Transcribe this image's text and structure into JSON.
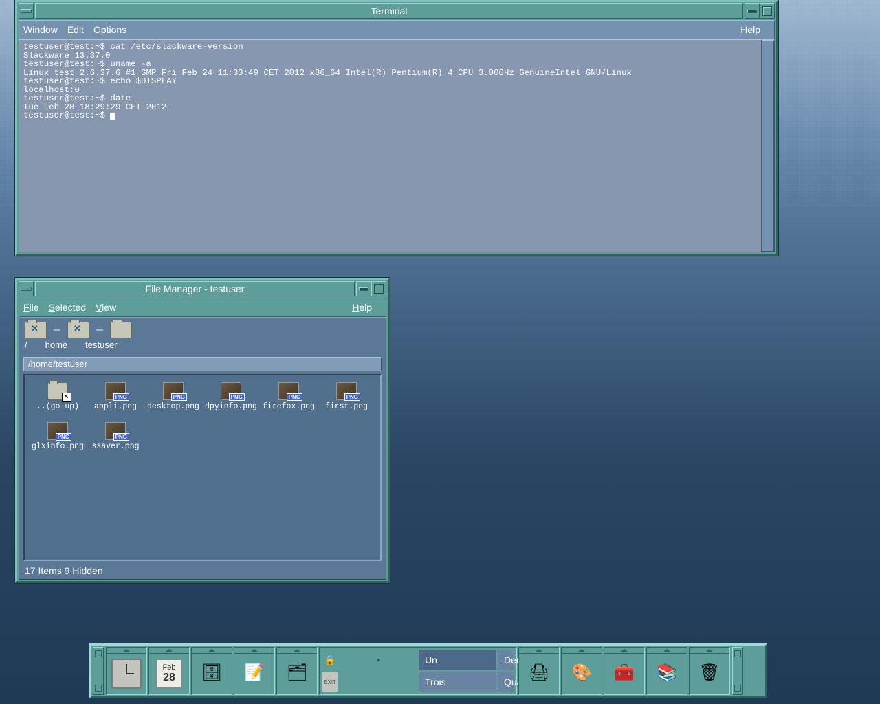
{
  "terminal": {
    "title": "Terminal",
    "menu": {
      "window": "Window",
      "edit": "Edit",
      "options": "Options",
      "help": "Help"
    },
    "lines": [
      "testuser@test:~$ cat /etc/slackware-version",
      "Slackware 13.37.0",
      "testuser@test:~$ uname -a",
      "Linux test 2.6.37.6 #1 SMP Fri Feb 24 11:33:49 CET 2012 x86_64 Intel(R) Pentium(R) 4 CPU 3.00GHz GenuineIntel GNU/Linux",
      "testuser@test:~$ echo $DISPLAY",
      "localhost:0",
      "testuser@test:~$ date",
      "Tue Feb 28 18:29:29 CET 2012",
      "testuser@test:~$ "
    ]
  },
  "file_manager": {
    "title": "File Manager - testuser",
    "menu": {
      "file": "File",
      "selected": "Selected",
      "view": "View",
      "help": "Help"
    },
    "breadcrumb": [
      "/",
      "home",
      "testuser"
    ],
    "path": "/home/testuser",
    "items": [
      {
        "label": "..(go up)",
        "type": "folder"
      },
      {
        "label": "appli.png",
        "type": "image"
      },
      {
        "label": "desktop.png",
        "type": "image"
      },
      {
        "label": "dpyinfo.png",
        "type": "image"
      },
      {
        "label": "firefox.png",
        "type": "image"
      },
      {
        "label": "first.png",
        "type": "image"
      },
      {
        "label": "glxinfo.png",
        "type": "image"
      },
      {
        "label": "ssaver.png",
        "type": "image"
      }
    ],
    "status": "17 Items 9 Hidden"
  },
  "panel": {
    "date_month": "Feb",
    "date_day": "28",
    "workspaces": [
      "Un",
      "Deux",
      "Trois",
      "Quatre"
    ],
    "active_workspace": "Un",
    "slots_left": [
      {
        "name": "clock-slot",
        "icon": "clock"
      },
      {
        "name": "calendar-slot",
        "icon": "date"
      },
      {
        "name": "file-cabinet-slot",
        "icon": "🗄"
      },
      {
        "name": "notepad-slot",
        "icon": "📝"
      },
      {
        "name": "mail-slot",
        "icon": "🗂"
      }
    ],
    "slots_right": [
      {
        "name": "printer-slot",
        "icon": "🖨"
      },
      {
        "name": "style-slot",
        "icon": "🎨"
      },
      {
        "name": "toolbox-slot",
        "icon": "🧰"
      },
      {
        "name": "help-slot",
        "icon": "📚"
      },
      {
        "name": "trash-slot",
        "icon": "🗑"
      }
    ],
    "lock_icon": "🔒",
    "exit_label": "EXIT"
  }
}
